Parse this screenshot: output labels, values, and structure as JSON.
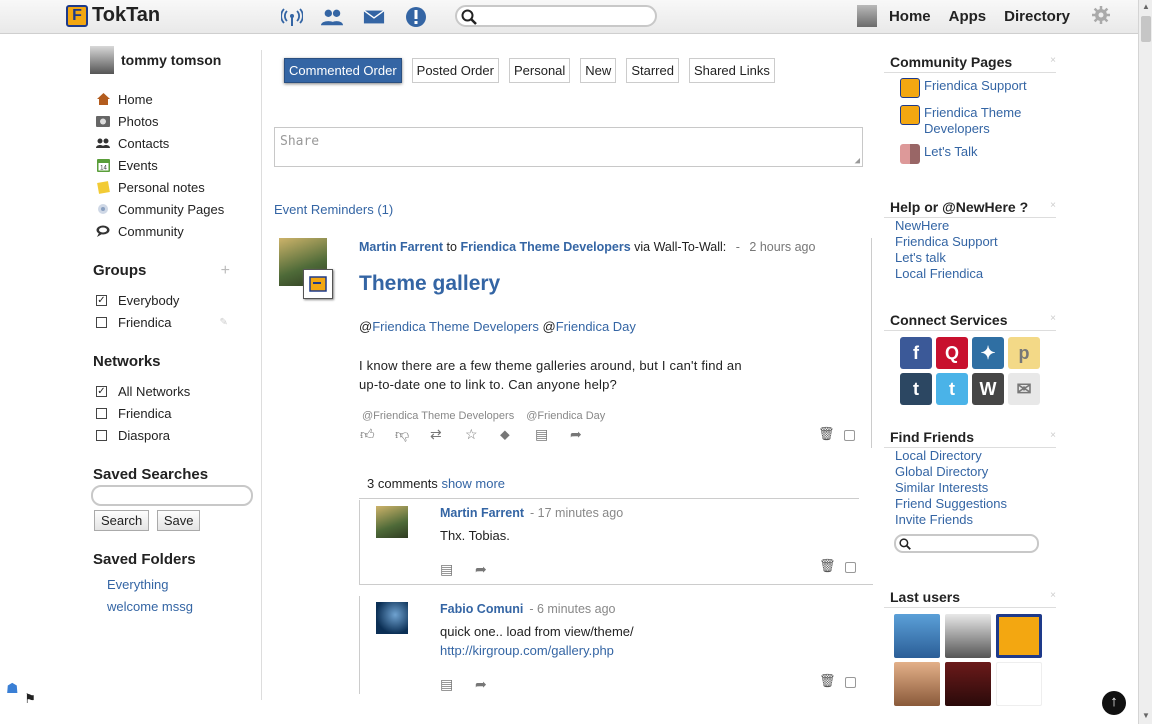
{
  "app": {
    "logo_letter": "F",
    "title": "TokTan"
  },
  "top": {
    "search_placeholder": "",
    "nav": [
      "Home",
      "Apps",
      "Directory"
    ],
    "icons": [
      "network-icon",
      "contacts-icon",
      "mail-icon",
      "notifications-icon"
    ]
  },
  "user": {
    "name": "tommy tomson"
  },
  "menu": [
    {
      "label": "Home",
      "icon": "home-icon"
    },
    {
      "label": "Photos",
      "icon": "photos-icon"
    },
    {
      "label": "Contacts",
      "icon": "contacts-icon"
    },
    {
      "label": "Events",
      "icon": "calendar-icon"
    },
    {
      "label": "Personal notes",
      "icon": "notes-icon"
    },
    {
      "label": "Community Pages",
      "icon": "community-pages-icon"
    },
    {
      "label": "Community",
      "icon": "community-icon"
    }
  ],
  "groups": {
    "heading": "Groups",
    "add": "+",
    "items": [
      {
        "label": "Everybody",
        "checked": true
      },
      {
        "label": "Friendica",
        "checked": false
      }
    ]
  },
  "networks": {
    "heading": "Networks",
    "items": [
      {
        "label": "All Networks",
        "checked": true
      },
      {
        "label": "Friendica",
        "checked": false
      },
      {
        "label": "Diaspora",
        "checked": false
      }
    ]
  },
  "saved_searches": {
    "heading": "Saved Searches",
    "search_btn": "Search",
    "save_btn": "Save"
  },
  "saved_folders": {
    "heading": "Saved Folders",
    "items": [
      "Everything",
      "welcome mssg"
    ]
  },
  "tabs": [
    {
      "label": "Commented Order",
      "active": true
    },
    {
      "label": "Posted Order",
      "active": false
    },
    {
      "label": "Personal",
      "active": false
    },
    {
      "label": "New",
      "active": false
    },
    {
      "label": "Starred",
      "active": false
    },
    {
      "label": "Shared Links",
      "active": false
    }
  ],
  "share_placeholder": "Share",
  "event_reminders": "Event Reminders (1)",
  "post": {
    "author": "Martin Farrent",
    "to_word": "to",
    "target": "Friendica Theme Developers",
    "via": "via Wall-To-Wall:",
    "sep": "-",
    "time": "2 hours ago",
    "title": "Theme gallery",
    "mention_at1": "@",
    "mention1": "Friendica Theme Developers",
    "mention_at2": "@",
    "mention2": "Friendica Day",
    "body_line1": "I know there are a few theme galleries around, but I can't find an",
    "body_line2": "up-to-date one to link to. Can anyone help?",
    "tag1": "@Friendica Theme Developers",
    "tag2": "@Friendica Day"
  },
  "comments_bar": {
    "count": "3 comments",
    "more": "show more"
  },
  "comments": [
    {
      "author": "Martin Farrent",
      "time": "- 17 minutes ago",
      "line1": "Thx. Tobias.",
      "line2": ""
    },
    {
      "author": "Fabio Comuni",
      "time": "- 6 minutes ago",
      "line1": "quick one.. load from view/theme/",
      "line2": "http://kirgroup.com/gallery.php"
    }
  ],
  "right": {
    "community_pages": {
      "heading": "Community Pages",
      "items": [
        "Friendica Support",
        "Friendica Theme Developers",
        "Let's Talk"
      ]
    },
    "help": {
      "heading": "Help or @NewHere ?",
      "items": [
        "NewHere",
        "Friendica Support",
        "Let's talk",
        "Local Friendica"
      ]
    },
    "connect": {
      "heading": "Connect Services",
      "services": [
        {
          "name": "facebook-icon",
          "glyph": "f",
          "color": "#3b5998"
        },
        {
          "name": "qwitter-icon",
          "glyph": "Q",
          "color": "#c8102e"
        },
        {
          "name": "statusnet-icon",
          "glyph": "✦",
          "color": "#2f6fa3"
        },
        {
          "name": "posterous-icon",
          "glyph": "p",
          "color": "#f3d987"
        },
        {
          "name": "tumblr-icon",
          "glyph": "t",
          "color": "#2c4762"
        },
        {
          "name": "twitter-icon",
          "glyph": "t",
          "color": "#4ab3e8"
        },
        {
          "name": "wordpress-icon",
          "glyph": "W",
          "color": "#464646"
        },
        {
          "name": "email-icon",
          "glyph": "✉",
          "color": "#e8e8e8"
        }
      ]
    },
    "find_friends": {
      "heading": "Find Friends",
      "items": [
        "Local Directory",
        "Global Directory",
        "Similar Interests",
        "Friend Suggestions",
        "Invite Friends"
      ]
    },
    "last_users": {
      "heading": "Last users"
    }
  },
  "close_glyph": "×"
}
